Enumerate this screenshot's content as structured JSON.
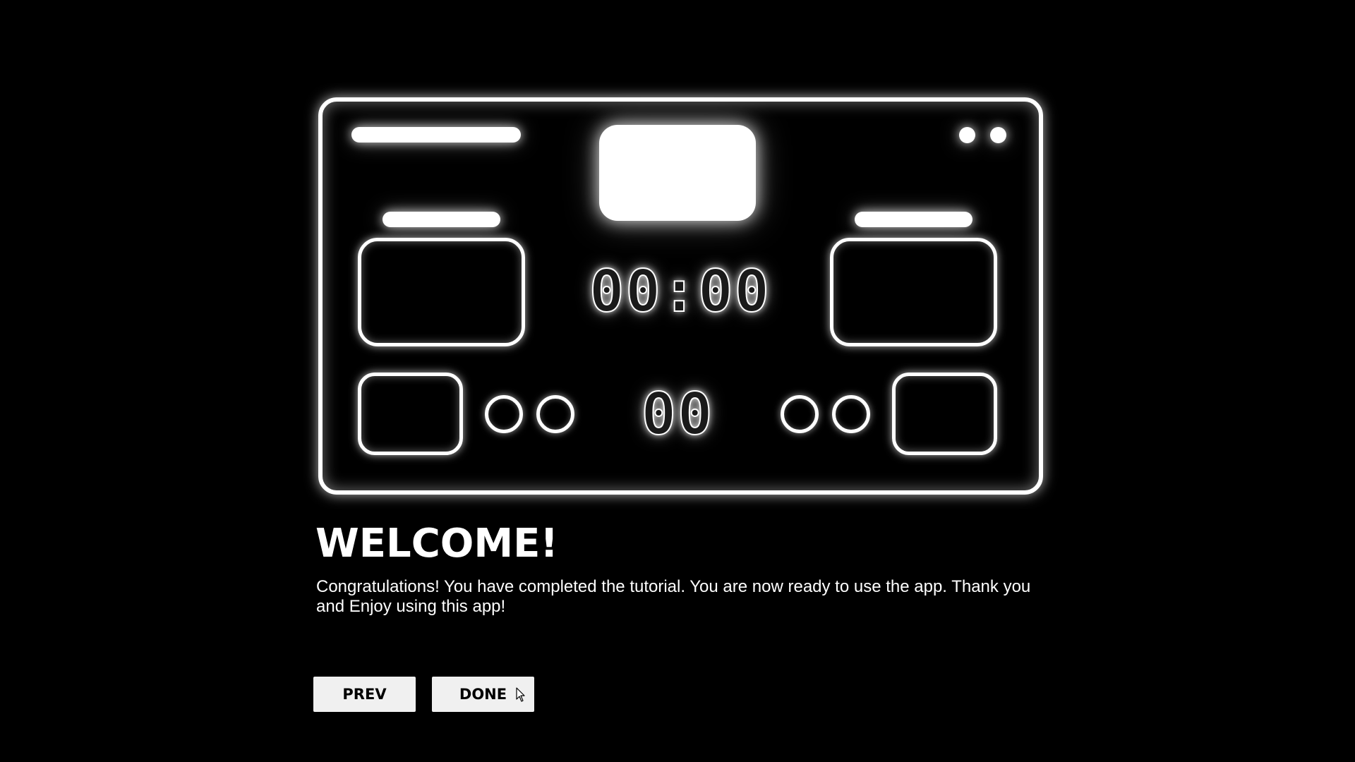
{
  "illustration": {
    "timer": "00:00",
    "period": "00"
  },
  "welcome": {
    "title": "WELCOME!",
    "message": "Congratulations! You have completed the tutorial. You are now ready to use the app. Thank you and Enjoy using this app!"
  },
  "buttons": {
    "prev_label": "PREV",
    "done_label": "DONE"
  },
  "colors": {
    "background": "#000000",
    "foreground": "#ffffff",
    "button_bg": "#f0f0f0"
  },
  "icons": [
    "scoreboard-illustration",
    "mouse-pointer-icon"
  ]
}
